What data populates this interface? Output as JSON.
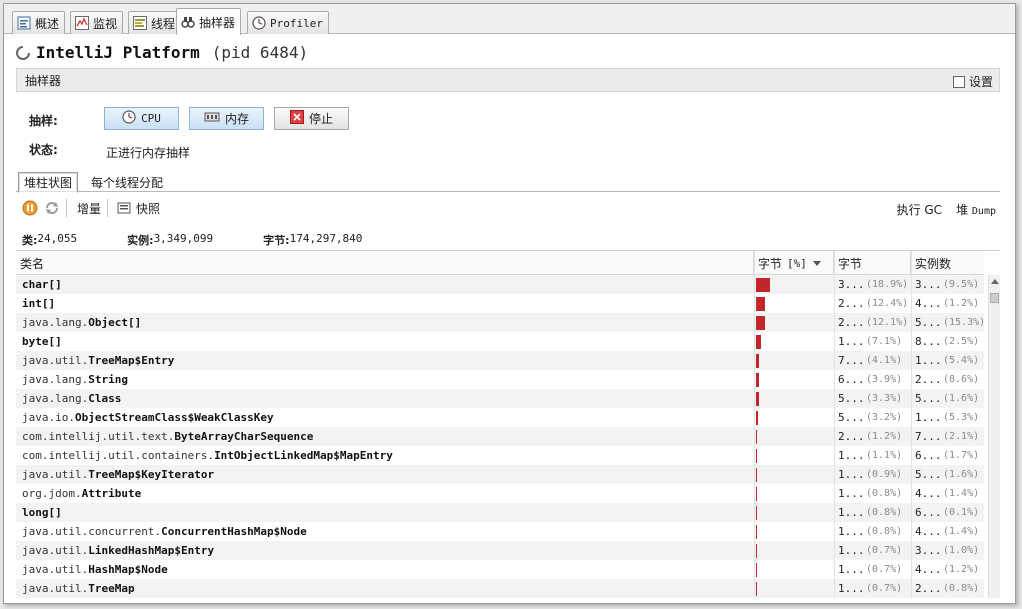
{
  "tabs": [
    {
      "label": "概述",
      "icon": "overview-icon"
    },
    {
      "label": "监视",
      "icon": "monitor-chart-icon"
    },
    {
      "label": "线程",
      "icon": "threads-icon"
    },
    {
      "label": "抽样器",
      "icon": "sampler-icon",
      "active": true
    },
    {
      "label": "Profiler",
      "icon": "profiler-clock-icon"
    }
  ],
  "app": {
    "title": "IntelliJ Platform",
    "pid": "(pid 6484)"
  },
  "section": {
    "title": "抽样器",
    "settings_label": "设置"
  },
  "controls": {
    "sample_label": "抽样:",
    "cpu_button": "CPU",
    "memory_button": "内存",
    "stop_button": "停止",
    "status_label": "状态:",
    "status_value": "正进行内存抽样"
  },
  "subtabs": [
    "堆柱状图",
    "每个线程分配"
  ],
  "toolbar": {
    "delta_label": "增量",
    "snapshot_label": "快照",
    "gc_label": "执行 GC",
    "heapdump_prefix": "堆",
    "heapdump_suffix": "Dump"
  },
  "stats": {
    "classes_label": "类:",
    "classes_value": "24,055",
    "instances_label": "实例:",
    "instances_value": "3,349,099",
    "bytes_label": "字节:",
    "bytes_value": "174,297,840"
  },
  "table": {
    "headers": {
      "name": "类名",
      "bytes_pct": "字节",
      "bytes_pct_unit": "[%]",
      "bytes": "字节",
      "instances": "实例数"
    },
    "rows": [
      {
        "pkg": "",
        "cls": "char[]",
        "pct": 18.9,
        "bytes": "3...",
        "bytes_pct": "(18.9%)",
        "inst": "3...",
        "inst_pct": "(9.5%)"
      },
      {
        "pkg": "",
        "cls": "int[]",
        "pct": 12.4,
        "bytes": "2...",
        "bytes_pct": "(12.4%)",
        "inst": "4...",
        "inst_pct": "(1.2%)"
      },
      {
        "pkg": "java.lang.",
        "cls": "Object[]",
        "pct": 12.1,
        "bytes": "2...",
        "bytes_pct": "(12.1%)",
        "inst": "5...",
        "inst_pct": "(15.3%)"
      },
      {
        "pkg": "",
        "cls": "byte[]",
        "pct": 7.1,
        "bytes": "1...",
        "bytes_pct": "(7.1%)",
        "inst": "8...",
        "inst_pct": "(2.5%)"
      },
      {
        "pkg": "java.util.",
        "cls": "TreeMap$Entry",
        "pct": 4.1,
        "bytes": "7...",
        "bytes_pct": "(4.1%)",
        "inst": "1...",
        "inst_pct": "(5.4%)"
      },
      {
        "pkg": "java.lang.",
        "cls": "String",
        "pct": 3.9,
        "bytes": "6...",
        "bytes_pct": "(3.9%)",
        "inst": "2...",
        "inst_pct": "(8.6%)"
      },
      {
        "pkg": "java.lang.",
        "cls": "Class",
        "pct": 3.3,
        "bytes": "5...",
        "bytes_pct": "(3.3%)",
        "inst": "5...",
        "inst_pct": "(1.6%)"
      },
      {
        "pkg": "java.io.",
        "cls": "ObjectStreamClass$WeakClassKey",
        "pct": 3.2,
        "bytes": "5...",
        "bytes_pct": "(3.2%)",
        "inst": "1...",
        "inst_pct": "(5.3%)"
      },
      {
        "pkg": "com.intellij.util.text.",
        "cls": "ByteArrayCharSequence",
        "pct": 1.2,
        "bytes": "2...",
        "bytes_pct": "(1.2%)",
        "inst": "7...",
        "inst_pct": "(2.1%)"
      },
      {
        "pkg": "com.intellij.util.containers.",
        "cls": "IntObjectLinkedMap$MapEntry",
        "pct": 1.1,
        "bytes": "1...",
        "bytes_pct": "(1.1%)",
        "inst": "6...",
        "inst_pct": "(1.7%)"
      },
      {
        "pkg": "java.util.",
        "cls": "TreeMap$KeyIterator",
        "pct": 0.9,
        "bytes": "1...",
        "bytes_pct": "(0.9%)",
        "inst": "5...",
        "inst_pct": "(1.6%)"
      },
      {
        "pkg": "org.jdom.",
        "cls": "Attribute",
        "pct": 0.8,
        "bytes": "1...",
        "bytes_pct": "(0.8%)",
        "inst": "4...",
        "inst_pct": "(1.4%)"
      },
      {
        "pkg": "",
        "cls": "long[]",
        "pct": 0.8,
        "bytes": "1...",
        "bytes_pct": "(0.8%)",
        "inst": "6...",
        "inst_pct": "(0.1%)"
      },
      {
        "pkg": "java.util.concurrent.",
        "cls": "ConcurrentHashMap$Node",
        "pct": 0.8,
        "bytes": "1...",
        "bytes_pct": "(0.8%)",
        "inst": "4...",
        "inst_pct": "(1.4%)"
      },
      {
        "pkg": "java.util.",
        "cls": "LinkedHashMap$Entry",
        "pct": 0.7,
        "bytes": "1...",
        "bytes_pct": "(0.7%)",
        "inst": "3...",
        "inst_pct": "(1.0%)"
      },
      {
        "pkg": "java.util.",
        "cls": "HashMap$Node",
        "pct": 0.7,
        "bytes": "1...",
        "bytes_pct": "(0.7%)",
        "inst": "4...",
        "inst_pct": "(1.2%)"
      },
      {
        "pkg": "java.util.",
        "cls": "TreeMap",
        "pct": 0.7,
        "bytes": "1...",
        "bytes_pct": "(0.7%)",
        "inst": "2...",
        "inst_pct": "(0.8%)"
      }
    ]
  },
  "colors": {
    "bar": "#c0262a",
    "button_blue": "#c9e0f5"
  }
}
